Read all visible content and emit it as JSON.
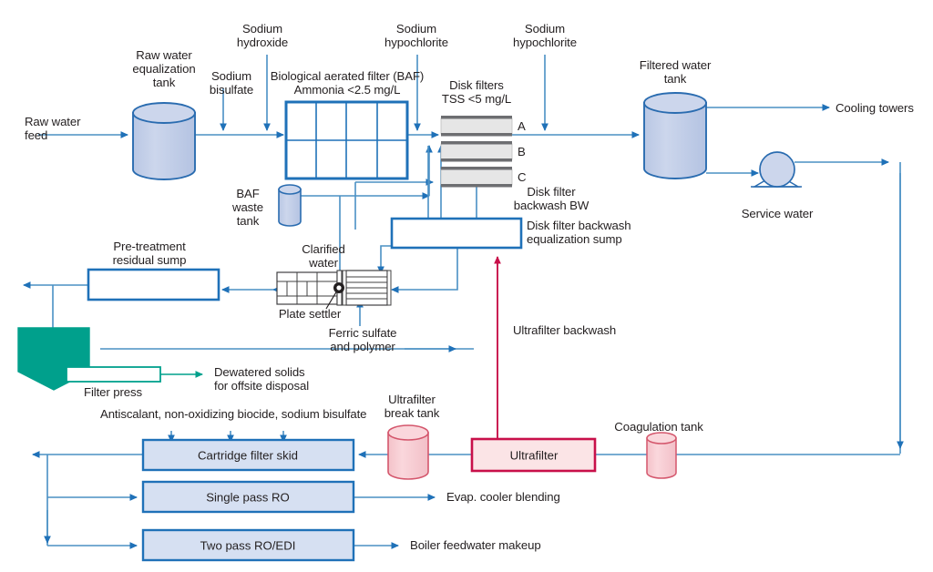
{
  "diagram": {
    "title": "Industrial water treatment process flow diagram",
    "colors": {
      "line_blue": "#1f71b8",
      "line_blue_light": "#4a90c4",
      "tank_fill": "#c3cfe8",
      "tank_stroke": "#2a6cb0",
      "box_fill": "#d6e0f2",
      "box_stroke": "#1f71b8",
      "disk_fill": "#e6e6e6",
      "disk_stroke": "#6d6e71",
      "teal": "#00a08c",
      "crimson": "#c8104a",
      "pink_fill": "#f7cdd2",
      "pink_light": "#fbe4e6",
      "text": "#231f20"
    }
  },
  "labels": {
    "raw_water_feed": "Raw water\nfeed",
    "raw_water_eq_tank": "Raw water\nequalization\ntank",
    "sodium_bisulfate": "Sodium\nbisulfate",
    "sodium_hydroxide": "Sodium\nhydroxide",
    "baf": "Biological aerated filter (BAF)\nAmmonia <2.5 mg/L",
    "sodium_hypochlorite_1": "Sodium\nhypochlorite",
    "sodium_hypochlorite_2": "Sodium\nhypochlorite",
    "disk_filters": "Disk filters\nTSS <5 mg/L",
    "disk_a": "A",
    "disk_b": "B",
    "disk_c": "C",
    "filtered_water_tank": "Filtered water\ntank",
    "cooling_towers": "Cooling towers",
    "service_water": "Service water",
    "baf_waste_tank": "BAF\nwaste\ntank",
    "disk_filter_backwash_bw": "Disk filter\nbackwash BW",
    "disk_filter_backwash_sump": "Disk filter backwash\nequalization sump",
    "pre_treatment_residual_sump": "Pre-treatment\nresidual sump",
    "clarified_water": "Clarified\nwater",
    "plate_settler": "Plate settler",
    "ferric_sulfate_polymer": "Ferric sulfate\nand polymer",
    "ultrafilter_backwash": "Ultrafilter backwash",
    "filter_press": "Filter press",
    "dewatered_solids": "Dewatered solids\nfor offsite disposal",
    "antiscalant": "Antiscalant, non-oxidizing biocide, sodium bisulfate",
    "ultrafilter_break_tank": "Ultrafilter\nbreak tank",
    "coagulation_tank": "Coagulation tank",
    "cartridge_filter_skid": "Cartridge filter skid",
    "single_pass_ro": "Single pass RO",
    "two_pass_ro_edi": "Two pass RO/EDI",
    "ultrafilter": "Ultrafilter",
    "evap_cooler_blending": "Evap. cooler blending",
    "boiler_feedwater_makeup": "Boiler feedwater makeup"
  }
}
